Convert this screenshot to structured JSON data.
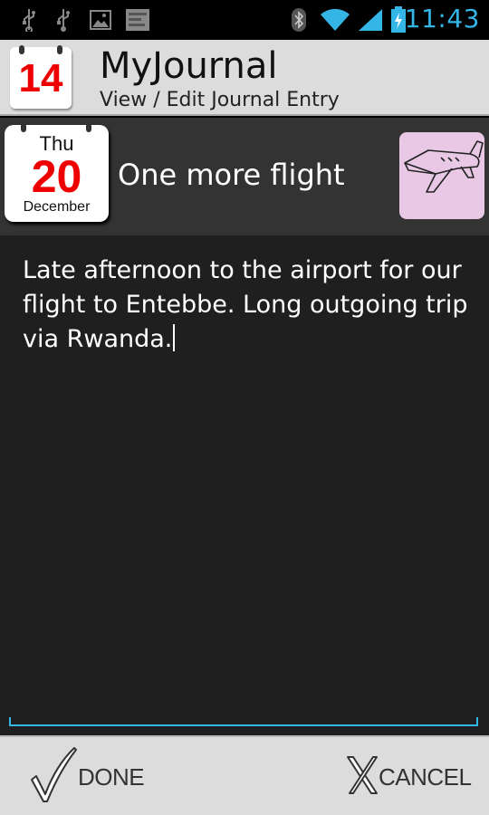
{
  "status_bar": {
    "time": "11:43",
    "icons": [
      "usb-icon",
      "usb-icon",
      "gallery-icon",
      "notification-icon",
      "bluetooth-icon",
      "wifi-icon",
      "signal-icon",
      "battery-charging-icon"
    ],
    "accent_color": "#33b5e5"
  },
  "app": {
    "icon_number": "14",
    "title": "MyJournal",
    "subtitle": "View / Edit Journal Entry"
  },
  "entry": {
    "day_of_week": "Thu",
    "day": "20",
    "month": "December",
    "title": "One more flight",
    "mood_icon": "airplane-icon",
    "body": "Late afternoon to the airport for our flight to Entebbe. Long outgoing trip via Rwanda."
  },
  "actions": {
    "done_label": "DONE",
    "cancel_label": "CANCEL"
  }
}
